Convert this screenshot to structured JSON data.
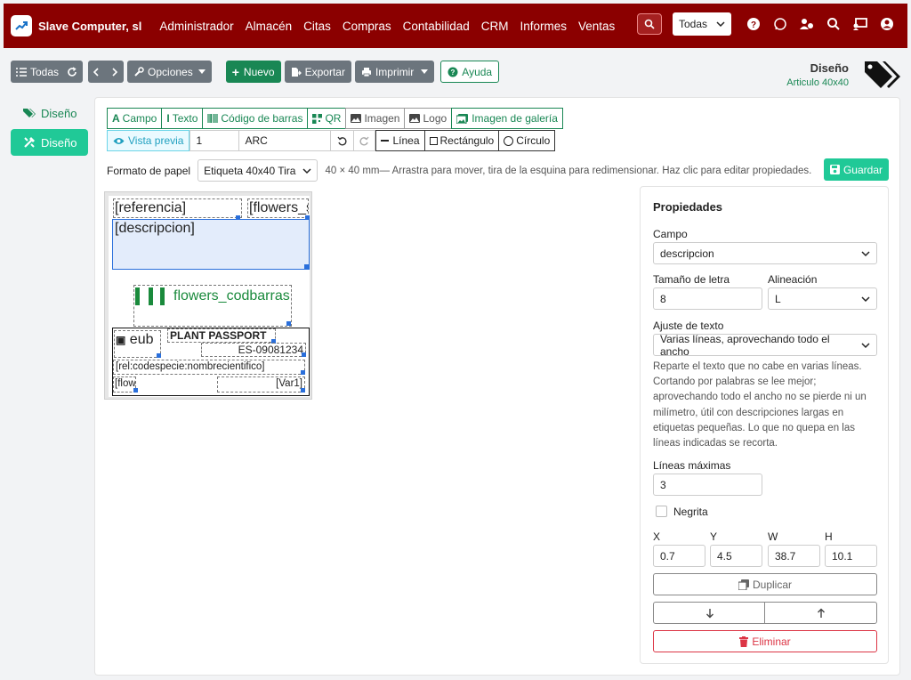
{
  "topbar": {
    "brand": "Slave Computer, sl",
    "nav": [
      "Administrador",
      "Almacén",
      "Citas",
      "Compras",
      "Contabilidad",
      "CRM",
      "Informes",
      "Ventas"
    ],
    "scope_select": "Todas"
  },
  "toolbar": {
    "all_label": "Todas",
    "options_label": "Opciones",
    "new_label": "Nuevo",
    "export_label": "Exportar",
    "print_label": "Imprimir",
    "help_label": "Ayuda"
  },
  "header": {
    "title": "Diseño",
    "subtitle": "Articulo 40x40"
  },
  "sidebar": {
    "items": [
      {
        "label": "Diseño",
        "active": false
      },
      {
        "label": "Diseño",
        "active": true
      }
    ]
  },
  "designer": {
    "insert_buttons": [
      "Campo",
      "Texto",
      "Código de barras",
      "QR",
      "Imagen",
      "Logo",
      "Imagen de galería"
    ],
    "preview_label": "Vista previa",
    "preview_qty": "1",
    "preview_ref": "ARC",
    "shape_buttons": [
      "Línea",
      "Rectángulo",
      "Círculo"
    ],
    "paper_label": "Formato de papel",
    "paper_value": "Etiqueta 40x40 Tira",
    "hint": "40 × 40 mm— Arrastra para mover, tira de la esquina para redimensionar. Haz clic para editar propiedades.",
    "save_label": "Guardar"
  },
  "label_fields": {
    "referencia": "[referencia]",
    "flowers_s": "[flowers_s",
    "descripcion": "[descripcion]",
    "barcode_text": "flowers_codbarras",
    "eub": "eub",
    "plant_passport": "PLANT PASSPORT",
    "es_code": "ES-09081234",
    "nombre": "[rel:codespecie:nombrecientifico]",
    "flow": "[flow",
    "var1": "[Var1]"
  },
  "properties": {
    "title": "Propiedades",
    "campo_label": "Campo",
    "campo_value": "descripcion",
    "font_size_label": "Tamaño de letra",
    "font_size_value": "8",
    "align_label": "Alineación",
    "align_value": "L",
    "wrap_label": "Ajuste de texto",
    "wrap_value": "Varias líneas, aprovechando todo el ancho",
    "wrap_help": "Reparte el texto que no cabe en varias líneas. Cortando por palabras se lee mejor; aprovechando todo el ancho no se pierde ni un milímetro, útil con descripciones largas en etiquetas pequeñas. Lo que no quepa en las líneas indicadas se recorta.",
    "max_lines_label": "Líneas máximas",
    "max_lines_value": "3",
    "bold_label": "Negrita",
    "x_label": "X",
    "x_value": "0.7",
    "y_label": "Y",
    "y_value": "4.5",
    "w_label": "W",
    "w_value": "38.7",
    "h_label": "H",
    "h_value": "10.1",
    "duplicate_label": "Duplicar",
    "delete_label": "Eliminar"
  },
  "colors": {
    "topbar": "#8b0000",
    "accent": "#198754",
    "teal": "#20c997",
    "danger": "#dc3545"
  }
}
